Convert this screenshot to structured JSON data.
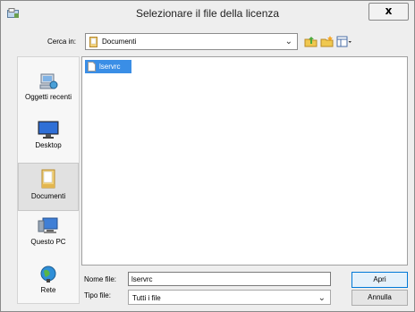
{
  "window": {
    "title": "Selezionare il file della licenza",
    "close_label": "x"
  },
  "lookin": {
    "label": "Cerca in:",
    "value": "Documenti"
  },
  "toolbar": {
    "icons": [
      "up-folder-icon",
      "new-folder-icon",
      "view-menu-icon"
    ]
  },
  "places": [
    {
      "label": "Oggetti recenti",
      "icon": "recent-items-icon"
    },
    {
      "label": "Desktop",
      "icon": "desktop-icon"
    },
    {
      "label": "Documenti",
      "icon": "documents-icon",
      "selected": true
    },
    {
      "label": "Questo PC",
      "icon": "computer-icon"
    },
    {
      "label": "Rete",
      "icon": "network-icon"
    }
  ],
  "files": [
    {
      "name": "lservrc",
      "selected": true
    }
  ],
  "filename": {
    "label": "Nome file:",
    "value": "lservrc"
  },
  "filetype": {
    "label": "Tipo file:",
    "value": "Tutti i file"
  },
  "buttons": {
    "open": "Apri",
    "cancel": "Annulla"
  },
  "colors": {
    "selection": "#3a8ee6",
    "primary_border": "#0078d7"
  }
}
